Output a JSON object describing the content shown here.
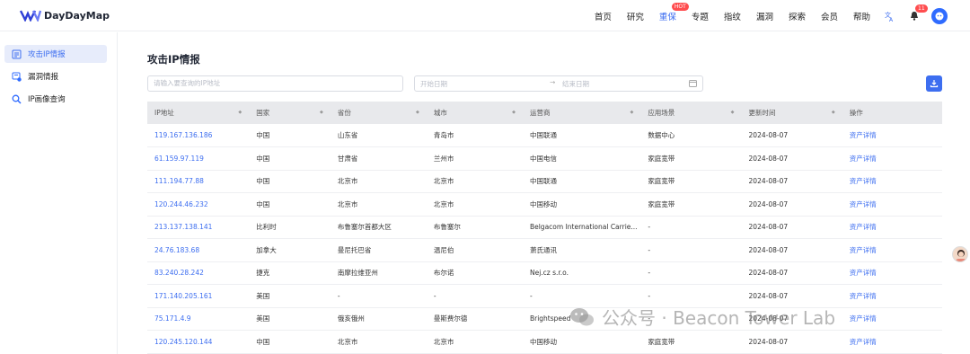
{
  "header": {
    "brand": "DayDayMap",
    "nav": [
      {
        "label": "首页",
        "active": false
      },
      {
        "label": "研究",
        "active": false
      },
      {
        "label": "重保",
        "active": true,
        "badge": "HOT"
      },
      {
        "label": "专题",
        "active": false
      },
      {
        "label": "指纹",
        "active": false
      },
      {
        "label": "漏洞",
        "active": false
      },
      {
        "label": "探索",
        "active": false
      },
      {
        "label": "会员",
        "active": false
      },
      {
        "label": "帮助",
        "active": false
      }
    ],
    "notification_count": "11",
    "accent": "#3d6ef0"
  },
  "sidebar": {
    "items": [
      {
        "label": "攻击IP情报",
        "icon": "document-icon",
        "active": true
      },
      {
        "label": "漏洞情报",
        "icon": "vulnerability-icon",
        "active": false
      },
      {
        "label": "IP画像查询",
        "icon": "search-ip-icon",
        "active": false
      }
    ]
  },
  "main": {
    "title": "攻击IP情报",
    "search_placeholder": "请输入要查询的IP地址",
    "date_start_placeholder": "开始日期",
    "date_end_placeholder": "结束日期",
    "columns": [
      "IP地址",
      "国家",
      "省份",
      "城市",
      "运营商",
      "应用场景",
      "更新时间",
      "操作"
    ],
    "rows": [
      [
        "119.167.136.186",
        "中国",
        "山东省",
        "青岛市",
        "中国联通",
        "数据中心",
        "2024-08-07",
        "资产详情"
      ],
      [
        "61.159.97.119",
        "中国",
        "甘肃省",
        "兰州市",
        "中国电信",
        "家庭宽带",
        "2024-08-07",
        "资产详情"
      ],
      [
        "111.194.77.88",
        "中国",
        "北京市",
        "北京市",
        "中国联通",
        "家庭宽带",
        "2024-08-07",
        "资产详情"
      ],
      [
        "120.244.46.232",
        "中国",
        "北京市",
        "北京市",
        "中国移动",
        "家庭宽带",
        "2024-08-07",
        "资产详情"
      ],
      [
        "213.137.138.141",
        "比利时",
        "布鲁塞尔首都大区",
        "布鲁塞尔",
        "Belgacom International Carrie...",
        "-",
        "2024-08-07",
        "资产详情"
      ],
      [
        "24.76.183.68",
        "加拿大",
        "曼尼托巴省",
        "温尼伯",
        "萧氏通讯",
        "-",
        "2024-08-07",
        "资产详情"
      ],
      [
        "83.240.28.242",
        "捷克",
        "南摩拉维亚州",
        "布尔诺",
        "Nej.cz s.r.o.",
        "-",
        "2024-08-07",
        "资产详情"
      ],
      [
        "171.140.205.161",
        "美国",
        "-",
        "-",
        "-",
        "-",
        "2024-08-07",
        "资产详情"
      ],
      [
        "75.171.4.9",
        "美国",
        "俄亥俄州",
        "曼斯费尔德",
        "Brightspeed",
        "-",
        "2024-08-07",
        "资产详情"
      ],
      [
        "120.245.120.144",
        "中国",
        "北京市",
        "北京市",
        "中国移动",
        "家庭宽带",
        "2024-08-07",
        "资产详情"
      ]
    ]
  },
  "watermark": "公众号 · Beacon Tower Lab"
}
